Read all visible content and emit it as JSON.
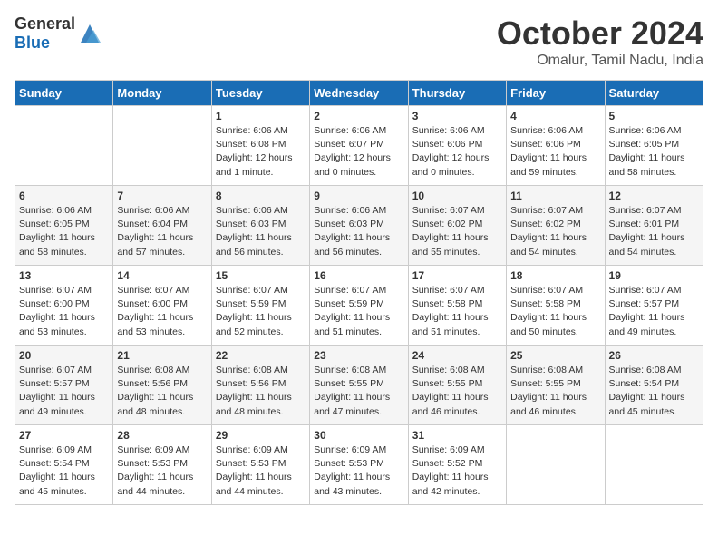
{
  "header": {
    "logo_general": "General",
    "logo_blue": "Blue",
    "month_title": "October 2024",
    "location": "Omalur, Tamil Nadu, India"
  },
  "weekdays": [
    "Sunday",
    "Monday",
    "Tuesday",
    "Wednesday",
    "Thursday",
    "Friday",
    "Saturday"
  ],
  "weeks": [
    [
      {
        "day": "",
        "info": ""
      },
      {
        "day": "",
        "info": ""
      },
      {
        "day": "1",
        "info": "Sunrise: 6:06 AM\nSunset: 6:08 PM\nDaylight: 12 hours\nand 1 minute."
      },
      {
        "day": "2",
        "info": "Sunrise: 6:06 AM\nSunset: 6:07 PM\nDaylight: 12 hours\nand 0 minutes."
      },
      {
        "day": "3",
        "info": "Sunrise: 6:06 AM\nSunset: 6:06 PM\nDaylight: 12 hours\nand 0 minutes."
      },
      {
        "day": "4",
        "info": "Sunrise: 6:06 AM\nSunset: 6:06 PM\nDaylight: 11 hours\nand 59 minutes."
      },
      {
        "day": "5",
        "info": "Sunrise: 6:06 AM\nSunset: 6:05 PM\nDaylight: 11 hours\nand 58 minutes."
      }
    ],
    [
      {
        "day": "6",
        "info": "Sunrise: 6:06 AM\nSunset: 6:05 PM\nDaylight: 11 hours\nand 58 minutes."
      },
      {
        "day": "7",
        "info": "Sunrise: 6:06 AM\nSunset: 6:04 PM\nDaylight: 11 hours\nand 57 minutes."
      },
      {
        "day": "8",
        "info": "Sunrise: 6:06 AM\nSunset: 6:03 PM\nDaylight: 11 hours\nand 56 minutes."
      },
      {
        "day": "9",
        "info": "Sunrise: 6:06 AM\nSunset: 6:03 PM\nDaylight: 11 hours\nand 56 minutes."
      },
      {
        "day": "10",
        "info": "Sunrise: 6:07 AM\nSunset: 6:02 PM\nDaylight: 11 hours\nand 55 minutes."
      },
      {
        "day": "11",
        "info": "Sunrise: 6:07 AM\nSunset: 6:02 PM\nDaylight: 11 hours\nand 54 minutes."
      },
      {
        "day": "12",
        "info": "Sunrise: 6:07 AM\nSunset: 6:01 PM\nDaylight: 11 hours\nand 54 minutes."
      }
    ],
    [
      {
        "day": "13",
        "info": "Sunrise: 6:07 AM\nSunset: 6:00 PM\nDaylight: 11 hours\nand 53 minutes."
      },
      {
        "day": "14",
        "info": "Sunrise: 6:07 AM\nSunset: 6:00 PM\nDaylight: 11 hours\nand 53 minutes."
      },
      {
        "day": "15",
        "info": "Sunrise: 6:07 AM\nSunset: 5:59 PM\nDaylight: 11 hours\nand 52 minutes."
      },
      {
        "day": "16",
        "info": "Sunrise: 6:07 AM\nSunset: 5:59 PM\nDaylight: 11 hours\nand 51 minutes."
      },
      {
        "day": "17",
        "info": "Sunrise: 6:07 AM\nSunset: 5:58 PM\nDaylight: 11 hours\nand 51 minutes."
      },
      {
        "day": "18",
        "info": "Sunrise: 6:07 AM\nSunset: 5:58 PM\nDaylight: 11 hours\nand 50 minutes."
      },
      {
        "day": "19",
        "info": "Sunrise: 6:07 AM\nSunset: 5:57 PM\nDaylight: 11 hours\nand 49 minutes."
      }
    ],
    [
      {
        "day": "20",
        "info": "Sunrise: 6:07 AM\nSunset: 5:57 PM\nDaylight: 11 hours\nand 49 minutes."
      },
      {
        "day": "21",
        "info": "Sunrise: 6:08 AM\nSunset: 5:56 PM\nDaylight: 11 hours\nand 48 minutes."
      },
      {
        "day": "22",
        "info": "Sunrise: 6:08 AM\nSunset: 5:56 PM\nDaylight: 11 hours\nand 48 minutes."
      },
      {
        "day": "23",
        "info": "Sunrise: 6:08 AM\nSunset: 5:55 PM\nDaylight: 11 hours\nand 47 minutes."
      },
      {
        "day": "24",
        "info": "Sunrise: 6:08 AM\nSunset: 5:55 PM\nDaylight: 11 hours\nand 46 minutes."
      },
      {
        "day": "25",
        "info": "Sunrise: 6:08 AM\nSunset: 5:55 PM\nDaylight: 11 hours\nand 46 minutes."
      },
      {
        "day": "26",
        "info": "Sunrise: 6:08 AM\nSunset: 5:54 PM\nDaylight: 11 hours\nand 45 minutes."
      }
    ],
    [
      {
        "day": "27",
        "info": "Sunrise: 6:09 AM\nSunset: 5:54 PM\nDaylight: 11 hours\nand 45 minutes."
      },
      {
        "day": "28",
        "info": "Sunrise: 6:09 AM\nSunset: 5:53 PM\nDaylight: 11 hours\nand 44 minutes."
      },
      {
        "day": "29",
        "info": "Sunrise: 6:09 AM\nSunset: 5:53 PM\nDaylight: 11 hours\nand 44 minutes."
      },
      {
        "day": "30",
        "info": "Sunrise: 6:09 AM\nSunset: 5:53 PM\nDaylight: 11 hours\nand 43 minutes."
      },
      {
        "day": "31",
        "info": "Sunrise: 6:09 AM\nSunset: 5:52 PM\nDaylight: 11 hours\nand 42 minutes."
      },
      {
        "day": "",
        "info": ""
      },
      {
        "day": "",
        "info": ""
      }
    ]
  ]
}
